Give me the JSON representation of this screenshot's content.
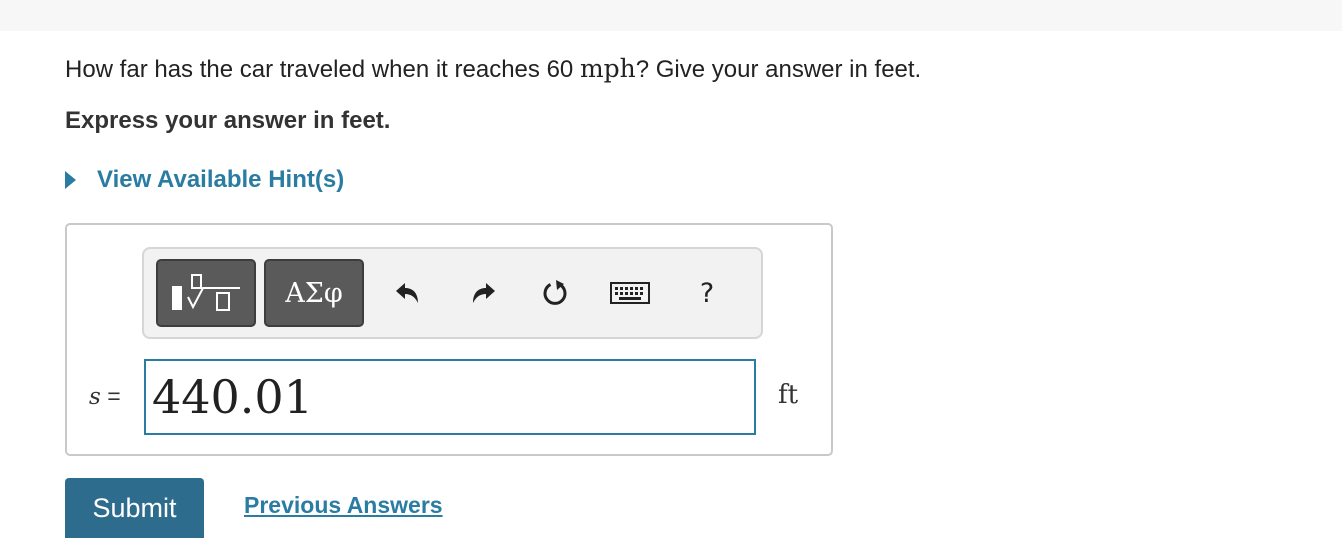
{
  "question": {
    "text_before": "How far has the car traveled when it reaches 60 ",
    "math_unit": "mph",
    "text_after": "? Give your answer in feet."
  },
  "instruction": "Express your answer in feet.",
  "hint": {
    "label": "View Available Hint(s)"
  },
  "toolbar": {
    "greek_label": "ΑΣφ",
    "help_label": "?",
    "icons": [
      "templates-icon",
      "undo-icon",
      "redo-icon",
      "reset-icon",
      "keyboard-icon",
      "help-icon"
    ]
  },
  "answer": {
    "variable": "s",
    "equals": "=",
    "value": "440.01",
    "unit": "ft"
  },
  "actions": {
    "submit_label": "Submit",
    "previous_label": "Previous Answers"
  },
  "colors": {
    "accent": "#2a7ca3",
    "submit_bg": "#2d6c8c",
    "toolbar_btn": "#5a5a5a"
  }
}
